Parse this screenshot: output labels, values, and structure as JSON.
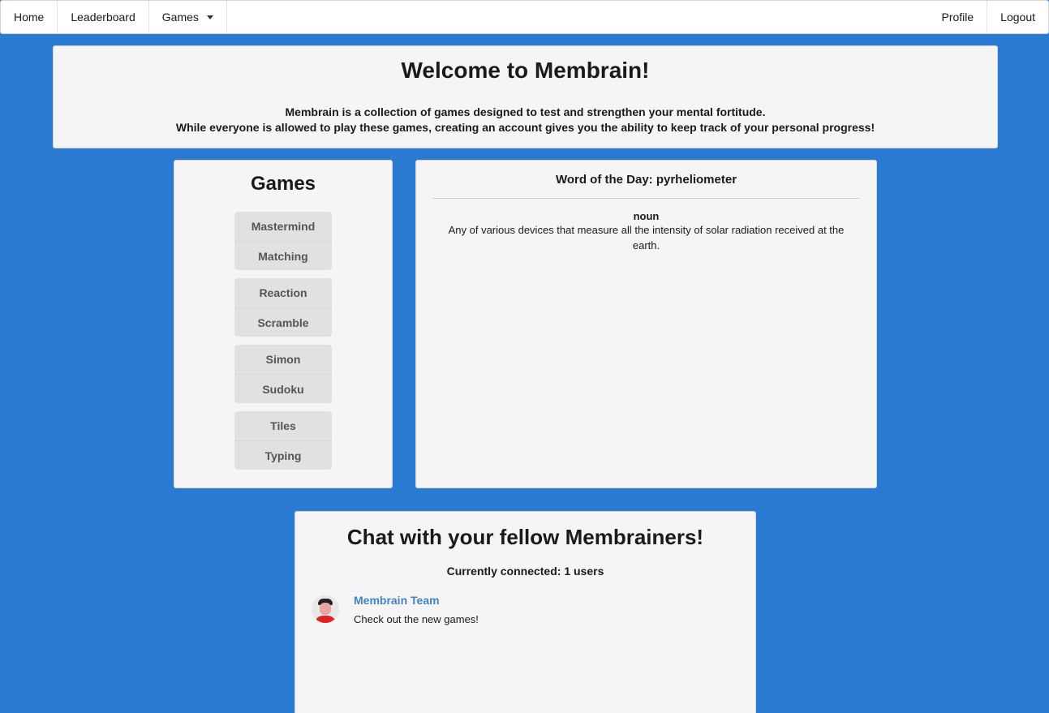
{
  "nav": {
    "home": "Home",
    "leaderboard": "Leaderboard",
    "games": "Games",
    "profile": "Profile",
    "logout": "Logout"
  },
  "welcome": {
    "title": "Welcome to Membrain!",
    "line1": "Membrain is a collection of games designed to test and strengthen your mental fortitude.",
    "line2": "While everyone is allowed to play these games, creating an account gives you the ability to keep track of your personal progress!"
  },
  "games": {
    "title": "Games",
    "items": [
      "Mastermind",
      "Matching",
      "Reaction",
      "Scramble",
      "Simon",
      "Sudoku",
      "Tiles",
      "Typing"
    ]
  },
  "word_of_day": {
    "title": "Word of the Day: pyrheliometer",
    "part_of_speech": "noun",
    "definition": "Any of various devices that measure all the intensity of solar radiation received at the earth."
  },
  "chat": {
    "title": "Chat with your fellow Membrainers!",
    "connected": "Currently connected: 1 users",
    "messages": [
      {
        "author": "Membrain Team",
        "text": "Check out the new games!"
      }
    ]
  },
  "colors": {
    "background": "#2a7ad2",
    "card": "#f5f5f5",
    "button": "#e0e1e2",
    "link": "#4183c4"
  }
}
